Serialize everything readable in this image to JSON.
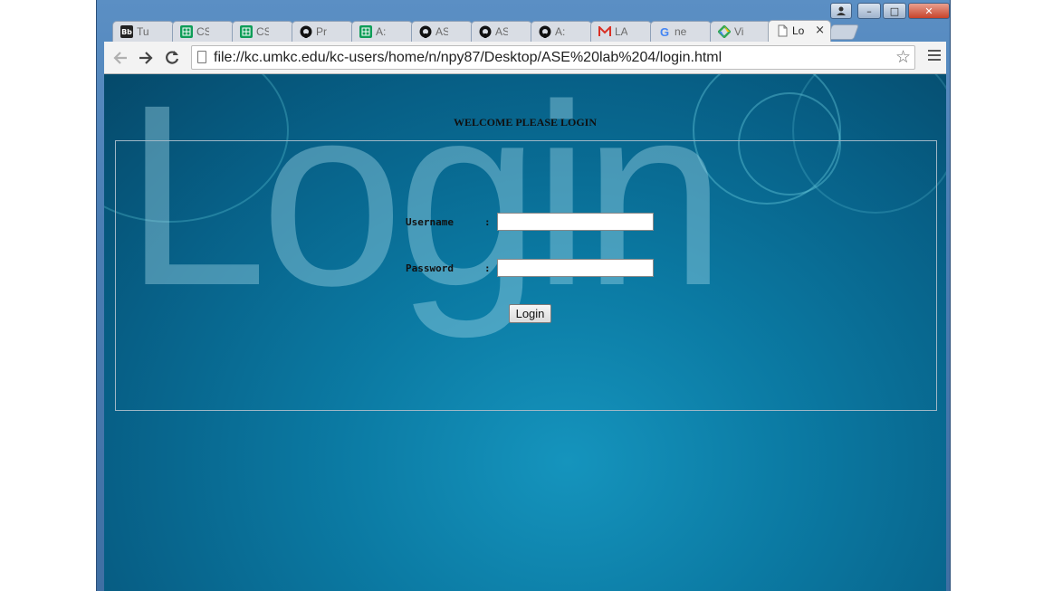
{
  "browser": {
    "tabs": [
      {
        "title": "Tu",
        "icon": "blackboard-icon",
        "active": false
      },
      {
        "title": "CS",
        "icon": "sheets-icon",
        "active": false
      },
      {
        "title": "CS",
        "icon": "sheets-icon",
        "active": false
      },
      {
        "title": "Pr",
        "icon": "github-icon",
        "active": false
      },
      {
        "title": "A:",
        "icon": "sheets-icon",
        "active": false
      },
      {
        "title": "AS",
        "icon": "github-icon",
        "active": false
      },
      {
        "title": "AS",
        "icon": "github-icon",
        "active": false
      },
      {
        "title": "A:",
        "icon": "github-icon",
        "active": false
      },
      {
        "title": "LA",
        "icon": "gmail-icon",
        "active": false
      },
      {
        "title": "ne",
        "icon": "google-icon",
        "active": false
      },
      {
        "title": "Vi",
        "icon": "chrome-webstore-icon",
        "active": false
      },
      {
        "title": "Lo",
        "icon": "page-icon",
        "active": true
      }
    ],
    "favicon_text": {
      "blackboard": "Bb"
    },
    "close_glyph": "×",
    "url": "file://kc.umkc.edu/kc-users/home/n/npy87/Desktop/ASE%20lab%204/login.html",
    "colors": {
      "github": "#000000",
      "sheets": "#0f9d58",
      "gmail": "#d93025",
      "google_blue": "#4285f4"
    }
  },
  "window_controls": {
    "minimize": "–",
    "maximize": "□",
    "close": "✕"
  },
  "page": {
    "background_word": "Login",
    "welcome": "WELCOME PLEASE LOGIN",
    "username_label": "Username",
    "password_label": "Password",
    "colon": ":",
    "username_value": "",
    "password_value": "",
    "login_button": "Login",
    "colors": {
      "background": "#0b7aa3",
      "box_border": "#9fb7c6"
    }
  }
}
